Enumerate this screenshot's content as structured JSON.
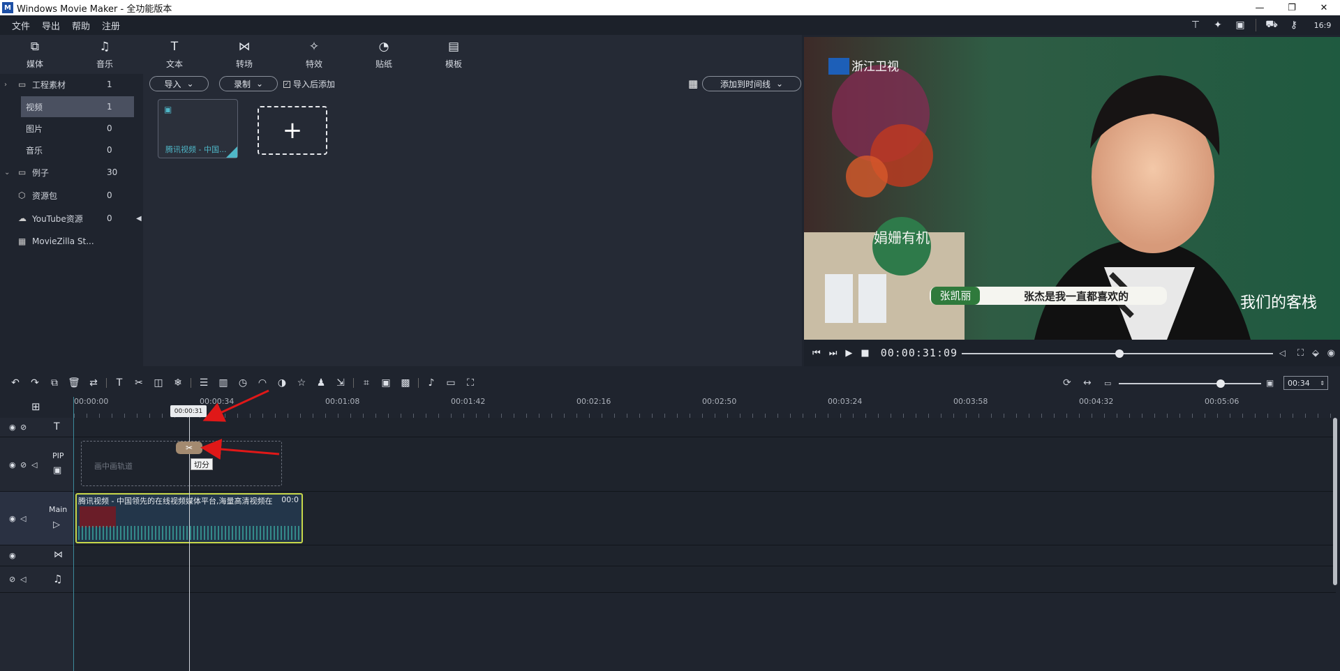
{
  "window": {
    "title": "Windows Movie Maker  - 全功能版本",
    "logo": "M",
    "buttons": [
      "—",
      "❐",
      "✕"
    ]
  },
  "menu": [
    "文件",
    "导出",
    "帮助",
    "注册"
  ],
  "toolbar": [
    {
      "label": "媒体",
      "icon": "media-icon"
    },
    {
      "label": "音乐",
      "icon": "music-icon"
    },
    {
      "label": "文本",
      "icon": "text-icon"
    },
    {
      "label": "转场",
      "icon": "transition-icon"
    },
    {
      "label": "特效",
      "icon": "effects-icon"
    },
    {
      "label": "贴纸",
      "icon": "sticker-icon"
    },
    {
      "label": "模板",
      "icon": "template-icon"
    }
  ],
  "sidebar": [
    {
      "label": "工程素材",
      "count": "1"
    },
    {
      "label": "视频",
      "count": "1"
    },
    {
      "label": "图片",
      "count": "0"
    },
    {
      "label": "音乐",
      "count": "0"
    },
    {
      "label": "例子",
      "count": "30"
    },
    {
      "label": "资源包",
      "count": "0"
    },
    {
      "label": "YouTube资源",
      "count": "0"
    },
    {
      "label": "MovieZilla St...",
      "count": ""
    }
  ],
  "media": {
    "import_label": "导入",
    "record_label": "录制",
    "auto_add_label": "导入后添加",
    "add_to_timeline_label": "添加到时间线",
    "clip_name": "腾讯视频 - 中国..."
  },
  "player": {
    "timecode": "00:00:31:09",
    "overlay_text": "张杰是我一直都喜欢的",
    "name_tag": "张凯丽",
    "brand": "浙江卫视",
    "sign": "娟姗有机",
    "show_logo": "我们的客栈"
  },
  "timeline": {
    "zoom_value": "00:34",
    "ruler": [
      "00:00:00",
      "00:00:34",
      "00:01:08",
      "00:01:42",
      "00:02:16",
      "00:02:50",
      "00:03:24",
      "00:03:58",
      "00:04:32",
      "00:05:06"
    ],
    "playhead_time": "00:00:31",
    "pip_label": "PIP",
    "main_label": "Main",
    "pip_placeholder": "画中画轨道",
    "cut_tooltip": "切分",
    "clip_title": "腾讯视频 - 中国领先的在线视频媒体平台,海量高清视频在",
    "clip_duration": "00:0"
  },
  "colors": {
    "accent": "#4fb7c8",
    "clip_border": "#c8d84a",
    "arrow": "#e01818"
  }
}
